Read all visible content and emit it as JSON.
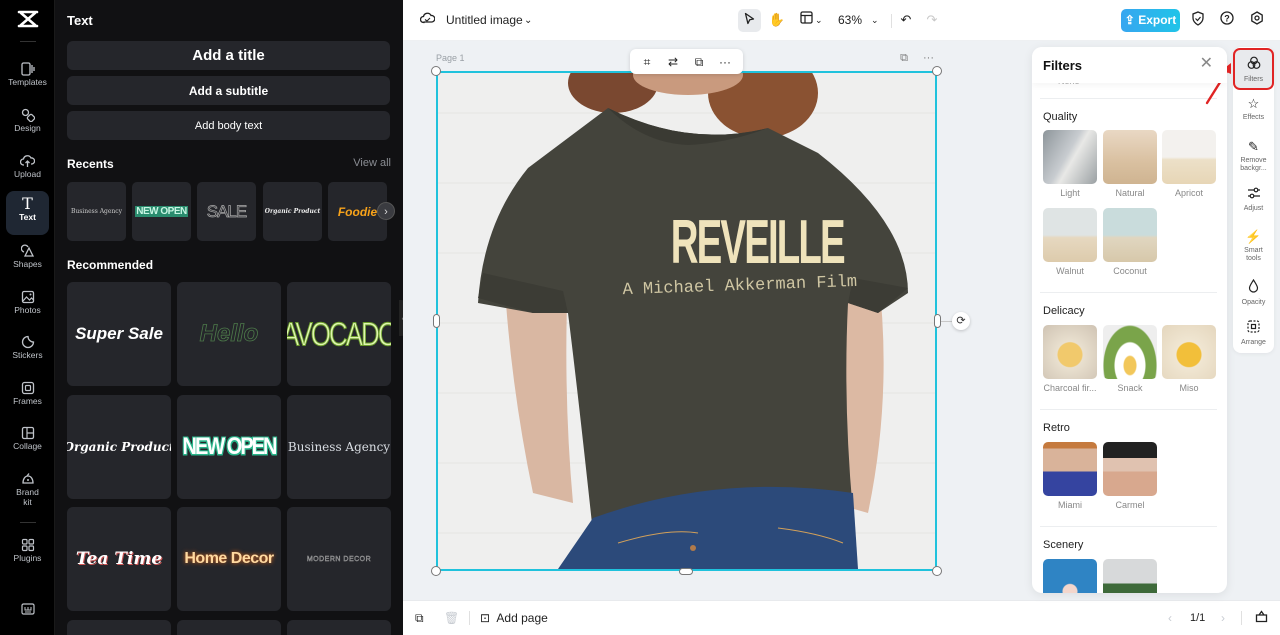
{
  "app": {
    "logo": "capcut-logo"
  },
  "rail": {
    "items": [
      {
        "label": "Templates",
        "icon": "templates-icon"
      },
      {
        "label": "Design",
        "icon": "design-icon"
      },
      {
        "label": "Upload",
        "icon": "upload-icon"
      },
      {
        "label": "Text",
        "icon": "text-icon",
        "active": true
      },
      {
        "label": "Shapes",
        "icon": "shapes-icon"
      },
      {
        "label": "Photos",
        "icon": "photos-icon"
      },
      {
        "label": "Stickers",
        "icon": "stickers-icon"
      },
      {
        "label": "Frames",
        "icon": "frames-icon"
      },
      {
        "label": "Collage",
        "icon": "collage-icon"
      },
      {
        "label": "Brand kit",
        "icon": "brand-kit-icon"
      },
      {
        "label": "Plugins",
        "icon": "plugins-icon"
      }
    ],
    "keyboard_icon": "keyboard-shortcuts-icon"
  },
  "panel": {
    "title": "Text",
    "add_title": "Add a title",
    "add_subtitle": "Add a subtitle",
    "add_body": "Add body text",
    "recents_title": "Recents",
    "view_all": "View all",
    "recents": [
      "Business Agency",
      "NEW OPEN",
      "SALE",
      "Organic Product",
      "Foodie"
    ],
    "recommended_title": "Recommended",
    "recommended": [
      "Super Sale",
      "Hello",
      "AVOCADO",
      "Organic Product",
      "NEW OPEN",
      "Business Agency",
      "Tea Time",
      "Home Decor",
      "MODERN DECOR"
    ]
  },
  "topbar": {
    "doc_title": "Untitled image",
    "zoom": "63%",
    "export_label": "Export"
  },
  "canvas": {
    "page_label": "Page 1",
    "shirt_title": "REVEILLE",
    "shirt_subtitle": "A Michael Akkerman Film",
    "colors": {
      "selection": "#1fc2dc",
      "shirt": "#44443c",
      "print": "#efe3bb",
      "jeans": "#2c4a7a"
    }
  },
  "bottombar": {
    "add_page": "Add page",
    "page_indicator": "1/1"
  },
  "filters": {
    "title": "Filters",
    "none_label": "None",
    "sections": [
      {
        "title": "Quality",
        "items": [
          "Light",
          "Natural",
          "Apricot",
          "Walnut",
          "Coconut"
        ]
      },
      {
        "title": "Delicacy",
        "items": [
          "Charcoal fir...",
          "Snack",
          "Miso"
        ]
      },
      {
        "title": "Retro",
        "items": [
          "Miami",
          "Carmel"
        ]
      },
      {
        "title": "Scenery",
        "items": [
          "",
          ""
        ]
      }
    ]
  },
  "tools": [
    {
      "label": "Filters",
      "icon": "filters-icon",
      "active": true
    },
    {
      "label": "Effects",
      "icon": "effects-icon"
    },
    {
      "label": "Remove backgr...",
      "icon": "remove-background-icon"
    },
    {
      "label": "Adjust",
      "icon": "adjust-icon"
    },
    {
      "label": "Smart tools",
      "icon": "smart-tools-icon"
    },
    {
      "label": "Opacity",
      "icon": "opacity-icon"
    },
    {
      "label": "Arrange",
      "icon": "arrange-icon"
    }
  ],
  "annotation": {
    "color": "#e02424"
  }
}
